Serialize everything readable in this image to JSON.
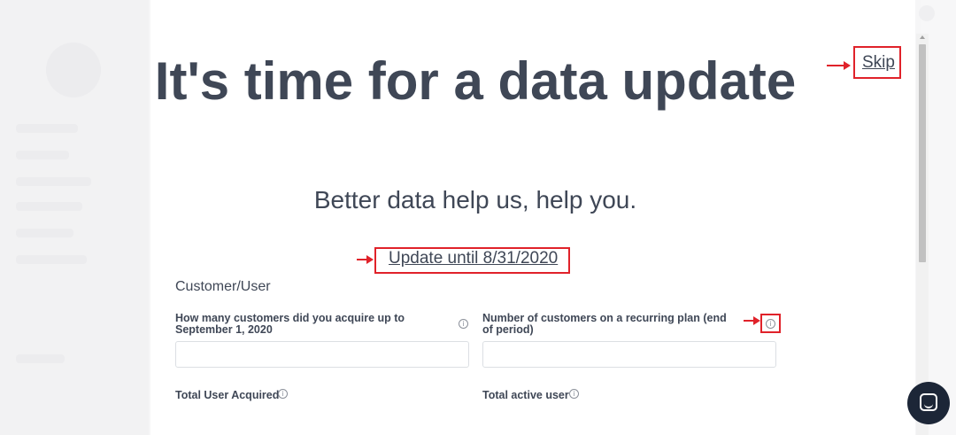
{
  "modal": {
    "title": "It's time for a data update",
    "subtitle": "Better data help us, help you.",
    "skip_label": "Skip",
    "update_label": "Update until 8/31/2020",
    "section_title": "Customer/User",
    "fields": [
      {
        "label": "How many customers did you acquire up to September 1, 2020",
        "value": ""
      },
      {
        "label": "Number of customers on a recurring plan (end of period)",
        "value": ""
      },
      {
        "label": "Total User Acquired"
      },
      {
        "label": "Total active user"
      }
    ],
    "info_glyph": "i"
  },
  "colors": {
    "annotation_red": "#e0222a",
    "text_dark": "#3f4756",
    "chat_button": "#1c2637"
  },
  "icons": {
    "info": "info-circle-icon",
    "chat": "chat-bubble-icon",
    "arrow": "annotation-arrow-icon"
  }
}
